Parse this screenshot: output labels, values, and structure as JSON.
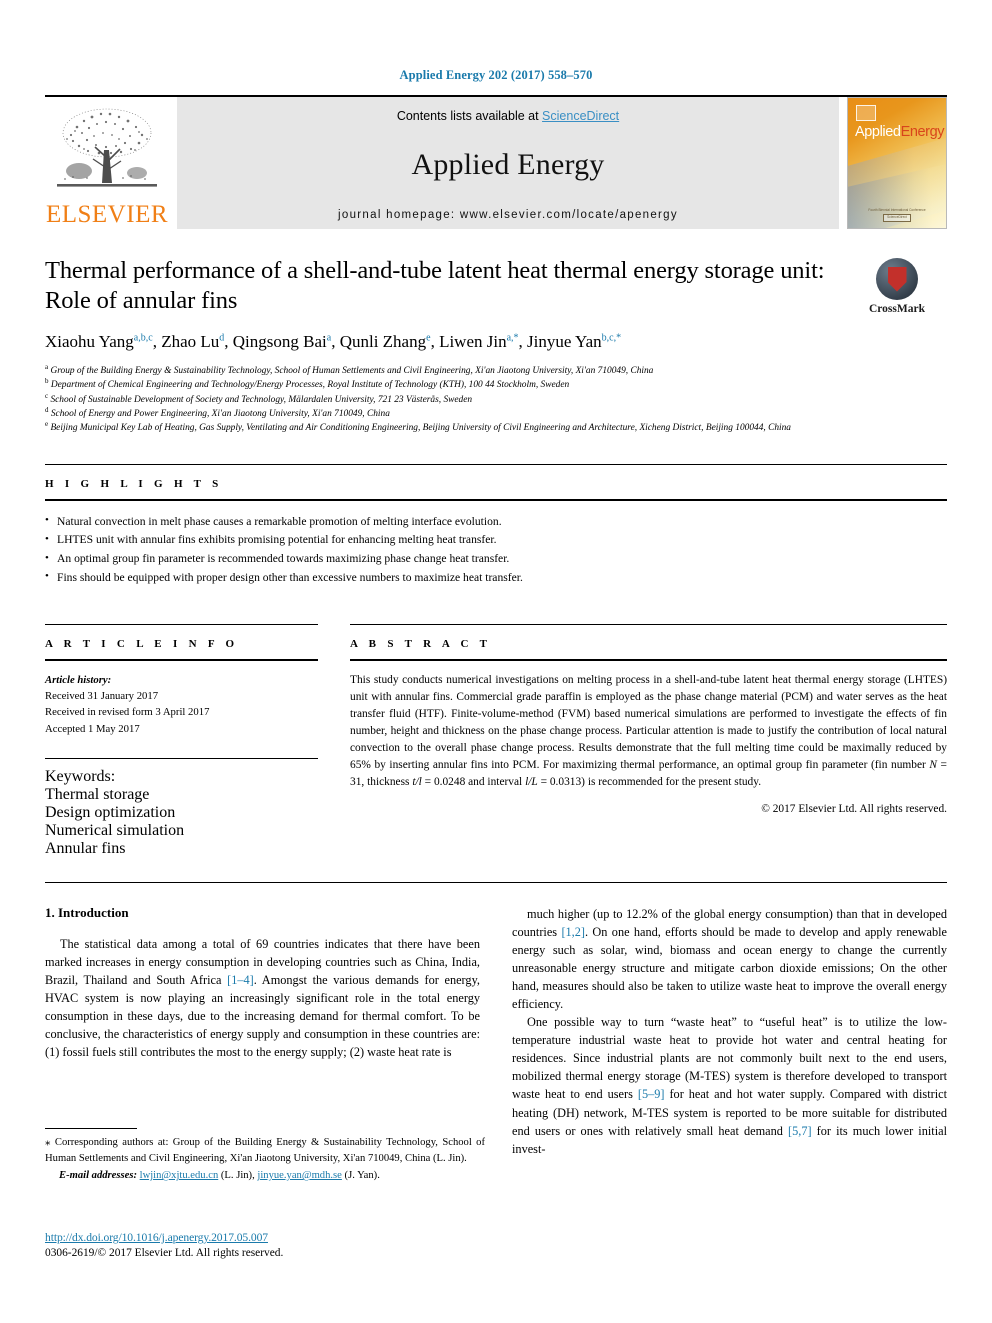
{
  "running_head": "Applied Energy 202 (2017) 558–570",
  "masthead": {
    "elsevier_wordmark": "ELSEVIER",
    "contents_prefix": "Contents lists available at ",
    "sciencedirect": "ScienceDirect",
    "journal_name": "Applied Energy",
    "homepage": "journal homepage: www.elsevier.com/locate/apenergy",
    "cover": {
      "applied": "Applied",
      "energy": "Energy",
      "footer_text": "Fourth Biennial International Conference",
      "badge": "ScienceDirect"
    }
  },
  "article": {
    "title": "Thermal performance of a shell-and-tube latent heat thermal energy storage unit: Role of annular fins",
    "crossmark_label": "CrossMark",
    "authors": [
      {
        "name": "Xiaohu Yang",
        "sup": "a,b,c",
        "sep": ", "
      },
      {
        "name": "Zhao Lu",
        "sup": "d",
        "sep": ", "
      },
      {
        "name": "Qingsong Bai",
        "sup": "a",
        "sep": ", "
      },
      {
        "name": "Qunli Zhang",
        "sup": "e",
        "sep": ", "
      },
      {
        "name": "Liwen Jin",
        "sup": "a,*",
        "sep": ", "
      },
      {
        "name": "Jinyue Yan",
        "sup": "b,c,*",
        "sep": ""
      }
    ],
    "affiliations": [
      {
        "marker": "a",
        "text": "Group of the Building Energy & Sustainability Technology, School of Human Settlements and Civil Engineering, Xi'an Jiaotong University, Xi'an 710049, China"
      },
      {
        "marker": "b",
        "text": "Department of Chemical Engineering and Technology/Energy Processes, Royal Institute of Technology (KTH), 100 44 Stockholm, Sweden"
      },
      {
        "marker": "c",
        "text": "School of Sustainable Development of Society and Technology, Mälardalen University, 721 23 Västerås, Sweden"
      },
      {
        "marker": "d",
        "text": "School of Energy and Power Engineering, Xi'an Jiaotong University, Xi'an 710049, China"
      },
      {
        "marker": "e",
        "text": "Beijing Municipal Key Lab of Heating, Gas Supply, Ventilating and Air Conditioning Engineering, Beijing University of Civil Engineering and Architecture, Xicheng District, Beijing 100044, China"
      }
    ]
  },
  "highlights": {
    "heading": "H I G H L I G H T S",
    "items": [
      "Natural convection in melt phase causes a remarkable promotion of melting interface evolution.",
      "LHTES unit with annular fins exhibits promising potential for enhancing melting heat transfer.",
      "An optimal group fin parameter is recommended towards maximizing phase change heat transfer.",
      "Fins should be equipped with proper design other than excessive numbers to maximize heat transfer."
    ]
  },
  "article_info": {
    "heading": "A R T I C L E   I N F O",
    "history_label": "Article history:",
    "history": [
      "Received 31 January 2017",
      "Received in revised form 3 April 2017",
      "Accepted 1 May 2017"
    ],
    "keywords_label": "Keywords:",
    "keywords": [
      "Thermal storage",
      "Design optimization",
      "Numerical simulation",
      "Annular fins"
    ]
  },
  "abstract": {
    "heading": "A B S T R A C T",
    "part1": "This study conducts numerical investigations on melting process in a shell-and-tube latent heat thermal energy storage (LHTES) unit with annular fins. Commercial grade paraffin is employed as the phase change material (PCM) and water serves as the heat transfer fluid (HTF). Finite-volume-method (FVM) based numerical simulations are performed to investigate the effects of fin number, height and thickness on the phase change process. Particular attention is made to justify the contribution of local natural convection to the overall phase change process. Results demonstrate that the full melting time could be maximally reduced by 65% by inserting annular fins into PCM. For maximizing thermal performance, an optimal group fin parameter (fin number ",
    "var_n": "N",
    "mid1": " = 31, thickness ",
    "var_t": "t",
    "mid2": "/l",
    "mid3": " = 0.0248 and interval ",
    "var_l": "l",
    "mid4": "/L",
    "mid5": " = 0.0313) is recommended for the present study.",
    "copyright": "© 2017 Elsevier Ltd. All rights reserved."
  },
  "body": {
    "section_number_title": "1. Introduction",
    "left_paragraph": "The statistical data among a total of 69 countries indicates that there have been marked increases in energy consumption in developing countries such as China, India, Brazil, Thailand and South Africa ",
    "left_ref": "[1–4]",
    "left_paragraph_cont": ". Amongst the various demands for energy, HVAC system is now playing an increasingly significant role in the total energy consumption in these days, due to the increasing demand for thermal comfort. To be conclusive, the characteristics of energy supply and consumption in these countries are: (1) fossil fuels still contributes the most to the energy supply; (2) waste heat rate is",
    "right_p1_a": "much higher (up to 12.2% of the global energy consumption) than that in developed countries ",
    "right_p1_ref": "[1,2]",
    "right_p1_b": ". On one hand, efforts should be made to develop and apply renewable energy such as solar, wind, biomass and ocean energy to change the currently unreasonable energy structure and mitigate carbon dioxide emissions; On the other hand, measures should also be taken to utilize waste heat to improve the overall energy efficiency.",
    "right_p2_a": "One possible way to turn “waste heat” to “useful heat” is to utilize the low-temperature industrial waste heat to provide hot water and central heating for residences. Since industrial plants are not commonly built next to the end users, mobilized thermal energy storage (M-TES) system is therefore developed to transport waste heat to end users ",
    "right_p2_ref1": "[5–9]",
    "right_p2_b": " for heat and hot water supply. Compared with district heating (DH) network, M-TES system is reported to be more suitable for distributed end users or ones with relatively small heat demand ",
    "right_p2_ref2": "[5,7]",
    "right_p2_c": " for its much lower initial invest-"
  },
  "footnote": {
    "star": "⁎",
    "text": " Corresponding authors at: Group of the Building Energy & Sustainability Technology, School of Human Settlements and Civil Engineering, Xi'an Jiaotong University, Xi'an 710049, China (L. Jin).",
    "email_label": "E-mail addresses:",
    "email1": "lwjin@xjtu.edu.cn",
    "email1_owner": " (L. Jin), ",
    "email2": "jinyue.yan@mdh.se",
    "email2_owner": " (J. Yan)."
  },
  "footer": {
    "doi": "http://dx.doi.org/10.1016/j.apenergy.2017.05.007",
    "issn": "0306-2619/© 2017 Elsevier Ltd. All rights reserved."
  }
}
